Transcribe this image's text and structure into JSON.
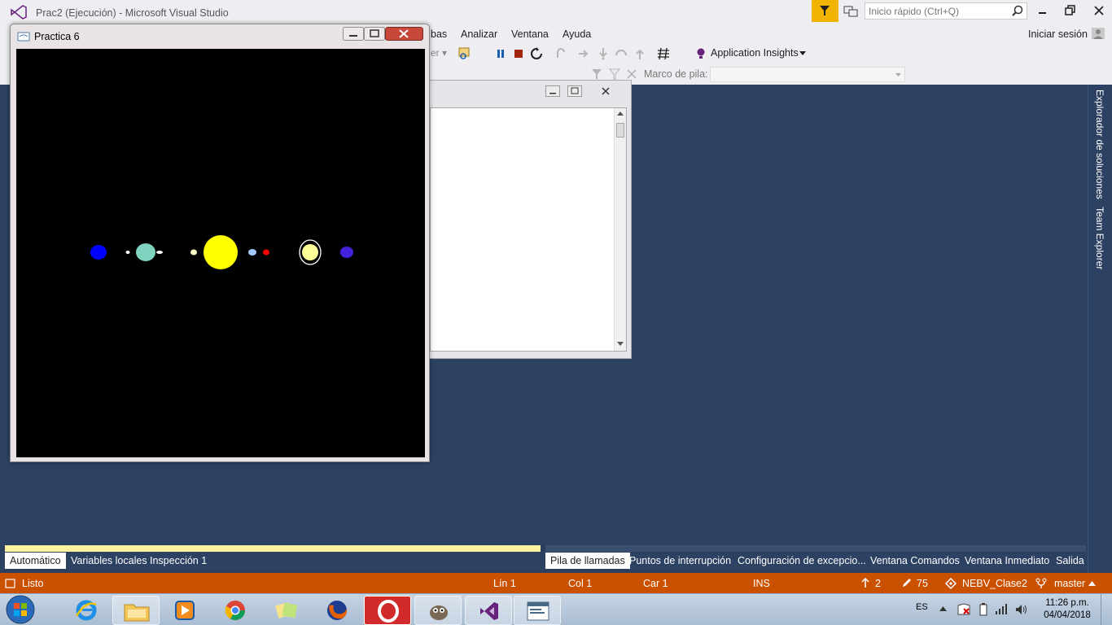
{
  "window": {
    "title": "Prac2 (Ejecución) - Microsoft Visual Studio",
    "quick_launch_placeholder": "Inicio rápido (Ctrl+Q)"
  },
  "menu": {
    "items": [
      "bas",
      "Analizar",
      "Ventana",
      "Ayuda"
    ],
    "sign_in": "Iniciar sesión"
  },
  "toolbar": {
    "app_insights": "Application Insights",
    "stack_frame_label": "Marco de pila:"
  },
  "sidepanel": {
    "tabs": [
      "Explorador de soluciones",
      "Team Explorer"
    ]
  },
  "practica_window": {
    "title": "Practica 6",
    "planets": [
      {
        "color": "#0000ff"
      },
      {
        "color": "#ffffff"
      },
      {
        "color": "#7fd4bf"
      },
      {
        "color": "#ffffcc"
      },
      {
        "color": "#ffff00"
      },
      {
        "color": "#a0c8ff"
      },
      {
        "color": "#ff0000"
      },
      {
        "color": "#ffff99"
      },
      {
        "color": "#4422dd"
      }
    ]
  },
  "bottom_tabs": {
    "left": [
      "Automático",
      "Variables locales",
      "Inspección 1"
    ],
    "right": [
      "Pila de llamadas",
      "Puntos de interrupción",
      "Configuración de excepcio...",
      "Ventana Comandos",
      "Ventana Inmediato",
      "Salida"
    ]
  },
  "status": {
    "state": "Listo",
    "line": "Lín 1",
    "col": "Col 1",
    "char": "Car 1",
    "mode": "INS",
    "push_count": "2",
    "edit_count": "75",
    "repo": "NEBV_Clase2",
    "branch": "master"
  },
  "taskbar": {
    "language": "ES",
    "time": "11:26 p.m.",
    "date": "04/04/2018"
  },
  "colors": {
    "accent": "#ca5100",
    "background": "#2d4163",
    "notification": "#f0b400"
  }
}
